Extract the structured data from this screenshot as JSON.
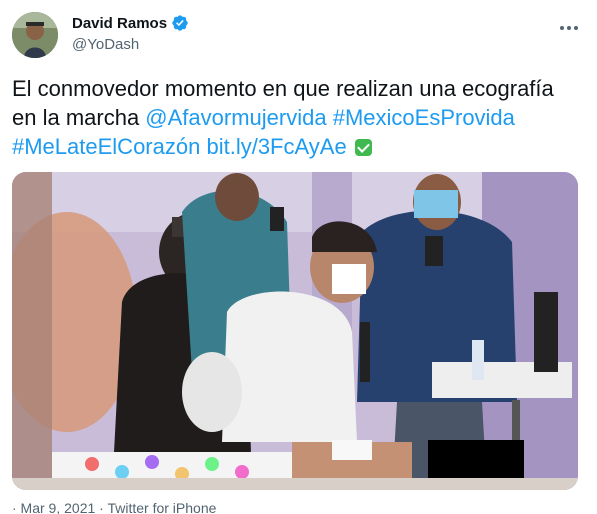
{
  "author": {
    "display_name": "David Ramos",
    "handle": "@YoDash",
    "verified": true,
    "avatar_icon": "user-avatar-photo"
  },
  "tweet": {
    "text_plain": "El conmovedor momento en que realizan una ecografía en la marcha ",
    "mention": "@Afavormujervida",
    "hashtag_1": "#MexicoEsProvida",
    "hashtag_2": "#MeLateElCorazón",
    "link": "bit.ly/3FcAyAe",
    "emoji": "check-mark-button-emoji"
  },
  "media": {
    "type": "photo",
    "description_icon": "ultrasound-at-march-photo"
  },
  "footer": {
    "partial_text": "· Mar 9, 2021 · Twitter for iPhone"
  },
  "colors": {
    "link": "#1d9bf0",
    "verified_badge": "#1d9bf0",
    "text": "#0f1419",
    "secondary": "#536471"
  }
}
